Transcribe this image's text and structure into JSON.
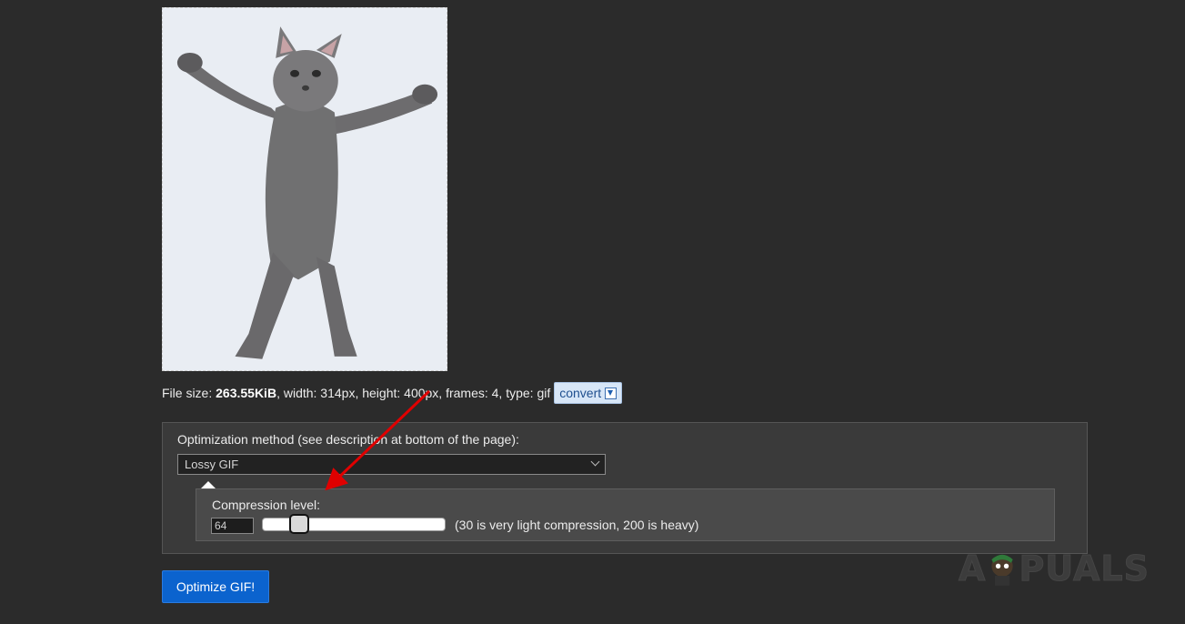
{
  "preview": {
    "alt": "dancing cat"
  },
  "file_info": {
    "prefix": "File size:",
    "size": "263.55KiB",
    "details": ", width: 314px, height: 400px, frames: 4, type: gif",
    "convert_label": "convert",
    "convert_icon": "download-arrow-icon"
  },
  "options": {
    "method_label": "Optimization method (see description at bottom of the page):",
    "method_selected": "Lossy GIF",
    "compression_label": "Compression level:",
    "compression_value": "64",
    "compression_fraction": 0.2,
    "compression_hint": "(30 is very light compression, 200 is heavy)"
  },
  "actions": {
    "optimize_label": "Optimize GIF!"
  },
  "watermark": {
    "text_left": "A",
    "text_right": "PUALS"
  },
  "colors": {
    "background": "#2b2b2b",
    "panel": "#3a3a3a",
    "button": "#0b63ce",
    "annotation_arrow": "#e00000"
  }
}
